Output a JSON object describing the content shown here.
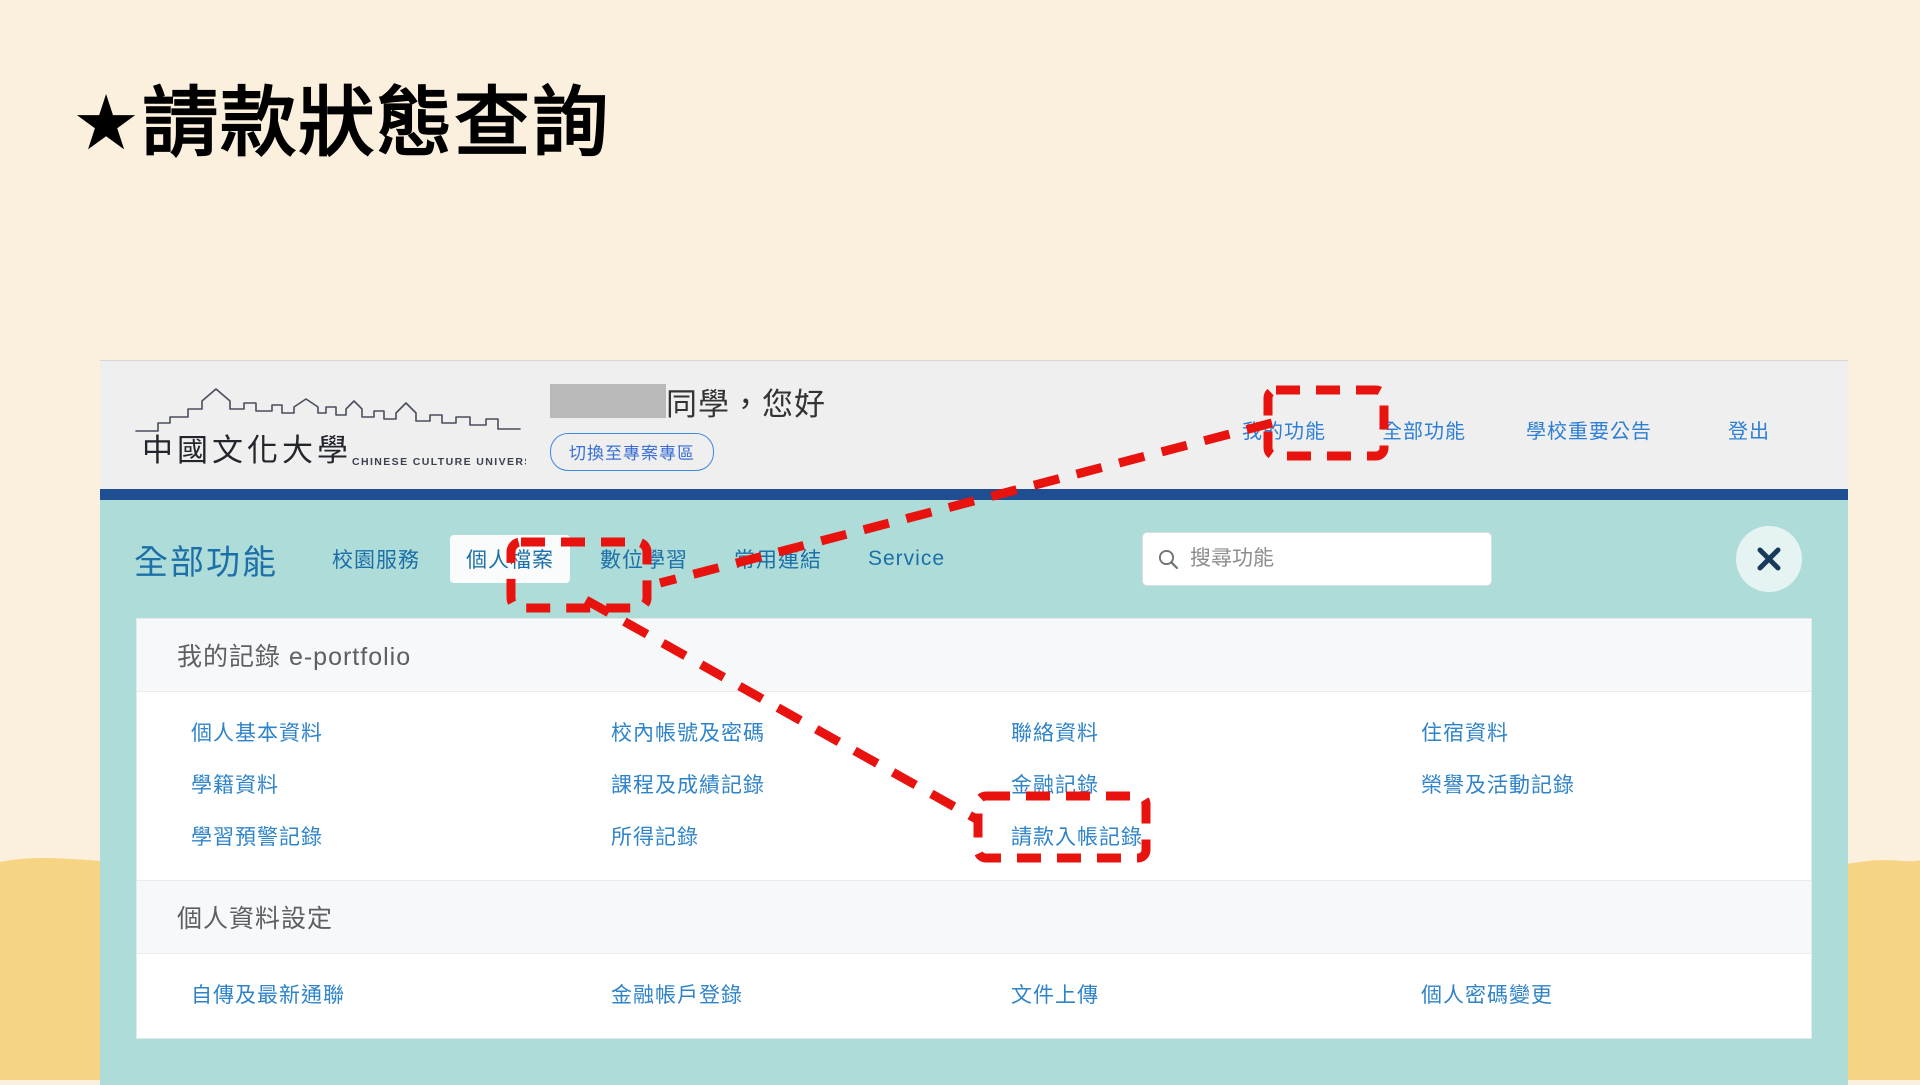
{
  "page": {
    "title": "★請款狀態查詢",
    "background_color": "#FBF0DE",
    "band_color": "#F7D483"
  },
  "header": {
    "logo_name_zh": "中國文化大學",
    "logo_name_en": "CHINESE CULTURE UNIVERSITY",
    "greeting_text": "同學，您好",
    "redacted_name_label": "",
    "switch_button": "切換至專案專區",
    "nav": [
      {
        "label": "我的功能"
      },
      {
        "label": "全部功能"
      },
      {
        "label": "學校重要公告"
      },
      {
        "label": "登出"
      }
    ]
  },
  "mega_menu": {
    "title": "全部功能",
    "accent_color": "#AEDCD8",
    "divider_color": "#1F4E92",
    "tabs": [
      {
        "label": "校園服務",
        "active": false
      },
      {
        "label": "個人檔案",
        "active": true
      },
      {
        "label": "數位學習",
        "active": false
      },
      {
        "label": "常用連結",
        "active": false
      },
      {
        "label": "Service",
        "active": false
      }
    ],
    "search": {
      "placeholder": "搜尋功能",
      "value": "",
      "icon": "search-icon"
    },
    "close_button": {
      "icon": "close-icon",
      "label": "✕"
    },
    "groups": [
      {
        "heading": "我的記錄 e-portfolio",
        "links": [
          "個人基本資料",
          "校內帳號及密碼",
          "聯絡資料",
          "住宿資料",
          "學籍資料",
          "課程及成績記錄",
          "金融記錄",
          "榮譽及活動記錄",
          "學習預警記錄",
          "所得記錄",
          "請款入帳記錄",
          ""
        ]
      },
      {
        "heading": "個人資料設定",
        "links": [
          "自傳及最新通聯",
          "金融帳戶登錄",
          "文件上傳",
          "個人密碼變更"
        ]
      }
    ]
  },
  "annotations": {
    "color": "#E8130F",
    "highlights": [
      {
        "target": "全部功能",
        "shape": "dashed-rect"
      },
      {
        "target": "個人檔案",
        "shape": "dashed-rect"
      },
      {
        "target": "請款入帳記錄",
        "shape": "dashed-rect"
      }
    ],
    "arrows": [
      {
        "from": "全部功能",
        "to": "個人檔案"
      },
      {
        "from": "個人檔案",
        "to": "請款入帳記錄"
      }
    ]
  }
}
